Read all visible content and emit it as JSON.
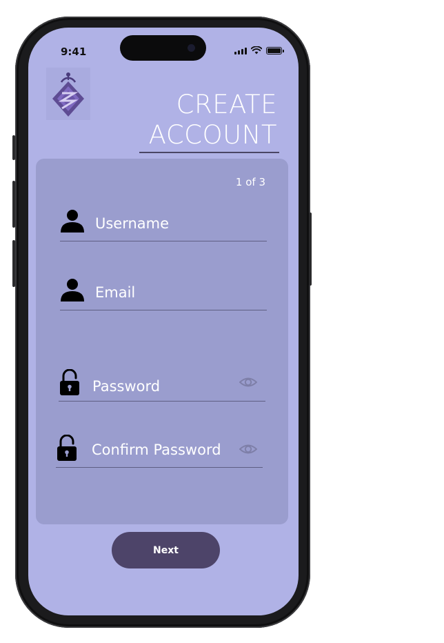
{
  "status_bar": {
    "time": "9:41"
  },
  "header": {
    "title_line1": "CREATE",
    "title_line2": "ACCOUNT"
  },
  "form": {
    "step": "1 of 3",
    "fields": [
      {
        "placeholder": "Username",
        "icon": "user-icon"
      },
      {
        "placeholder": "Email",
        "icon": "user-icon"
      },
      {
        "placeholder": "Password",
        "icon": "lock-open-icon",
        "toggle": "eye-icon"
      },
      {
        "placeholder": "Confirm Password",
        "icon": "lock-open-icon",
        "toggle": "eye-icon"
      }
    ]
  },
  "actions": {
    "next_label": "Next"
  },
  "colors": {
    "background": "#b0b2e6",
    "card": "#9a9dce",
    "button": "#4d4469",
    "text": "#ffffff"
  }
}
